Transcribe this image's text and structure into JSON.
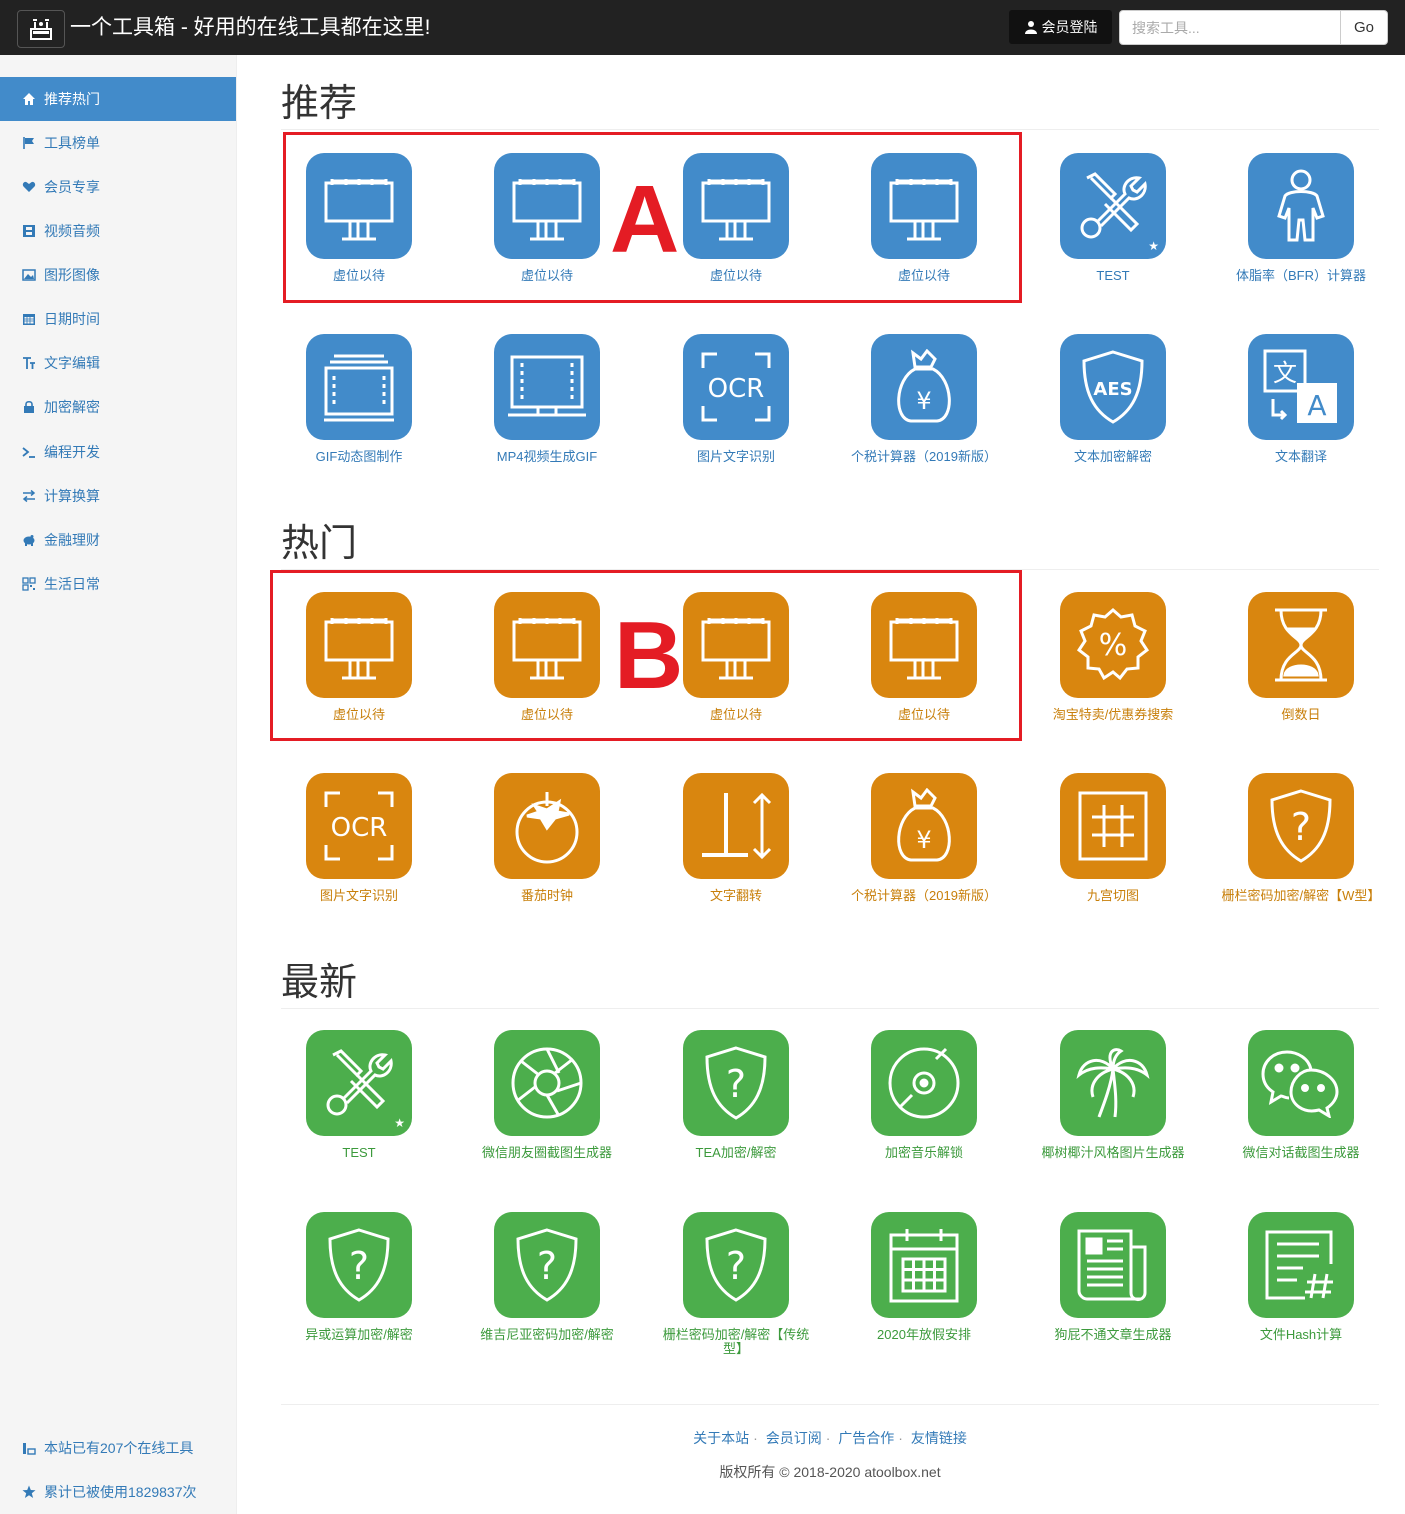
{
  "header": {
    "brand": "一个工具箱 - 好用的在线工具都在这里!",
    "login_label": "会员登陆",
    "search_placeholder": "搜索工具...",
    "go_label": "Go"
  },
  "sidebar": {
    "items": [
      {
        "label": "推荐热门",
        "icon": "home-icon"
      },
      {
        "label": "工具榜单",
        "icon": "flag-icon"
      },
      {
        "label": "会员专享",
        "icon": "heart-icon"
      },
      {
        "label": "视频音频",
        "icon": "film-icon"
      },
      {
        "label": "图形图像",
        "icon": "picture-icon"
      },
      {
        "label": "日期时间",
        "icon": "calendar-icon"
      },
      {
        "label": "文字编辑",
        "icon": "text-icon"
      },
      {
        "label": "加密解密",
        "icon": "lock-icon"
      },
      {
        "label": "编程开发",
        "icon": "terminal-icon"
      },
      {
        "label": "计算换算",
        "icon": "transfer-icon"
      },
      {
        "label": "金融理财",
        "icon": "piggy-bank-icon"
      },
      {
        "label": "生活日常",
        "icon": "qrcode-icon"
      }
    ],
    "stats": {
      "tool_count": "本站已有207个在线工具",
      "usage_count": "累计已被使用1829837次"
    }
  },
  "sections": {
    "recommend": {
      "title": "推荐",
      "tools": [
        {
          "label": "虚位以待",
          "icon": "billboard-icon"
        },
        {
          "label": "虚位以待",
          "icon": "billboard-icon"
        },
        {
          "label": "虚位以待",
          "icon": "billboard-icon"
        },
        {
          "label": "虚位以待",
          "icon": "billboard-icon"
        },
        {
          "label": "TEST",
          "icon": "tools-icon"
        },
        {
          "label": "体脂率（BFR）计算器",
          "icon": "body-icon"
        },
        {
          "label": "GIF动态图制作",
          "icon": "gif-film-icon"
        },
        {
          "label": "MP4视频生成GIF",
          "icon": "video-screen-icon"
        },
        {
          "label": "图片文字识别",
          "icon": "ocr-icon"
        },
        {
          "label": "个税计算器（2019新版）",
          "icon": "money-bag-icon"
        },
        {
          "label": "文本加密解密",
          "icon": "aes-shield-icon"
        },
        {
          "label": "文本翻译",
          "icon": "translate-icon"
        }
      ]
    },
    "hot": {
      "title": "热门",
      "tools": [
        {
          "label": "虚位以待",
          "icon": "billboard-icon"
        },
        {
          "label": "虚位以待",
          "icon": "billboard-icon"
        },
        {
          "label": "虚位以待",
          "icon": "billboard-icon"
        },
        {
          "label": "虚位以待",
          "icon": "billboard-icon"
        },
        {
          "label": "淘宝特卖/优惠券搜索",
          "icon": "discount-badge-icon"
        },
        {
          "label": "倒数日",
          "icon": "hourglass-icon"
        },
        {
          "label": "图片文字识别",
          "icon": "ocr-icon"
        },
        {
          "label": "番茄时钟",
          "icon": "tomato-icon"
        },
        {
          "label": "文字翻转",
          "icon": "text-flip-icon"
        },
        {
          "label": "个税计算器（2019新版）",
          "icon": "money-bag-icon"
        },
        {
          "label": "九宫切图",
          "icon": "grid-icon"
        },
        {
          "label": "栅栏密码加密/解密【W型】",
          "icon": "question-shield-icon"
        }
      ]
    },
    "latest": {
      "title": "最新",
      "tools": [
        {
          "label": "TEST",
          "icon": "tools-icon"
        },
        {
          "label": "微信朋友圈截图生成器",
          "icon": "aperture-icon"
        },
        {
          "label": "TEA加密/解密",
          "icon": "question-shield-icon"
        },
        {
          "label": "加密音乐解锁",
          "icon": "disc-icon"
        },
        {
          "label": "椰树椰汁风格图片生成器",
          "icon": "palm-tree-icon"
        },
        {
          "label": "微信对话截图生成器",
          "icon": "wechat-icon"
        },
        {
          "label": "异或运算加密/解密",
          "icon": "question-shield-icon"
        },
        {
          "label": "维吉尼亚密码加密/解密",
          "icon": "question-shield-icon"
        },
        {
          "label": "栅栏密码加密/解密【传统型】",
          "icon": "question-shield-icon"
        },
        {
          "label": "2020年放假安排",
          "icon": "calendar-grid-icon"
        },
        {
          "label": "狗屁不通文章生成器",
          "icon": "newspaper-icon"
        },
        {
          "label": "文件Hash计算",
          "icon": "hash-doc-icon"
        }
      ]
    }
  },
  "annotations": {
    "a": "A",
    "b": "B"
  },
  "footer": {
    "links": [
      "关于本站",
      "会员订阅",
      "广告合作",
      "友情链接"
    ],
    "copyright": "版权所有 © 2018-2020 atoolbox.net"
  },
  "colors": {
    "recommend": "#428bca",
    "hot": "#d9860f",
    "latest": "#4cae4c",
    "annotation": "#e41c24"
  }
}
